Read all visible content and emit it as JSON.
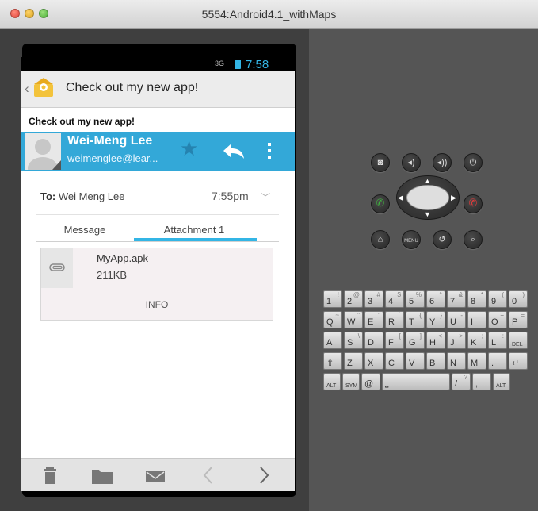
{
  "window": {
    "title": "5554:Android4.1_withMaps"
  },
  "status_bar": {
    "network": "3G",
    "time": "7:58"
  },
  "action_bar": {
    "title": "Check out my new app!"
  },
  "email": {
    "subject": "Check out my new app!",
    "sender_name": "Wei-Meng Lee",
    "sender_email": "weimenglee@lear...",
    "to_label": "To:",
    "to_value": "Wei Meng Lee",
    "time": "7:55pm"
  },
  "tabs": [
    {
      "label": "Message"
    },
    {
      "label": "Attachment 1"
    }
  ],
  "attachment": {
    "name": "MyApp.apk",
    "size": "211KB",
    "info_label": "INFO"
  },
  "controls": {
    "menu_label": "MENU"
  },
  "keyboard": {
    "rows": [
      [
        {
          "p": "1",
          "s": "!"
        },
        {
          "p": "2",
          "s": "@"
        },
        {
          "p": "3",
          "s": "#"
        },
        {
          "p": "4",
          "s": "$"
        },
        {
          "p": "5",
          "s": "%"
        },
        {
          "p": "6",
          "s": "^"
        },
        {
          "p": "7",
          "s": "&"
        },
        {
          "p": "8",
          "s": "*"
        },
        {
          "p": "9",
          "s": "("
        },
        {
          "p": "0",
          "s": ")"
        }
      ],
      [
        {
          "p": "Q",
          "s": "~"
        },
        {
          "p": "W",
          "s": "\""
        },
        {
          "p": "E",
          "s": "\""
        },
        {
          "p": "R",
          "s": "`"
        },
        {
          "p": "T",
          "s": "{"
        },
        {
          "p": "Y",
          "s": "}"
        },
        {
          "p": "U",
          "s": "-"
        },
        {
          "p": "I",
          "s": ""
        },
        {
          "p": "O",
          "s": "+"
        },
        {
          "p": "P",
          "s": "="
        }
      ],
      [
        {
          "p": "A",
          "s": ""
        },
        {
          "p": "S",
          "s": "\\"
        },
        {
          "p": "D",
          "s": ""
        },
        {
          "p": "F",
          "s": "["
        },
        {
          "p": "G",
          "s": "]"
        },
        {
          "p": "H",
          "s": "<"
        },
        {
          "p": "J",
          "s": ">"
        },
        {
          "p": "K",
          "s": ";"
        },
        {
          "p": "L",
          "s": ":"
        },
        {
          "p": "DEL",
          "s": ""
        }
      ],
      [
        {
          "p": "⇧",
          "s": ""
        },
        {
          "p": "Z",
          "s": ""
        },
        {
          "p": "X",
          "s": ""
        },
        {
          "p": "C",
          "s": ""
        },
        {
          "p": "V",
          "s": ""
        },
        {
          "p": "B",
          "s": ""
        },
        {
          "p": "N",
          "s": ""
        },
        {
          "p": "M",
          "s": ""
        },
        {
          "p": ".",
          "s": ""
        },
        {
          "p": "↵",
          "s": ""
        }
      ],
      [
        {
          "p": "ALT",
          "s": ""
        },
        {
          "p": "SYM",
          "s": ""
        },
        {
          "p": "@",
          "s": ""
        },
        {
          "p": "␣",
          "s": ""
        },
        {
          "p": "/",
          "s": "?"
        },
        {
          "p": ",",
          "s": ""
        },
        {
          "p": "ALT",
          "s": ""
        }
      ]
    ]
  },
  "colors": {
    "accent": "#33b5e5",
    "sender_bar": "#33a8d8",
    "call": "#3fae3f",
    "hangup": "#e03a3a"
  }
}
